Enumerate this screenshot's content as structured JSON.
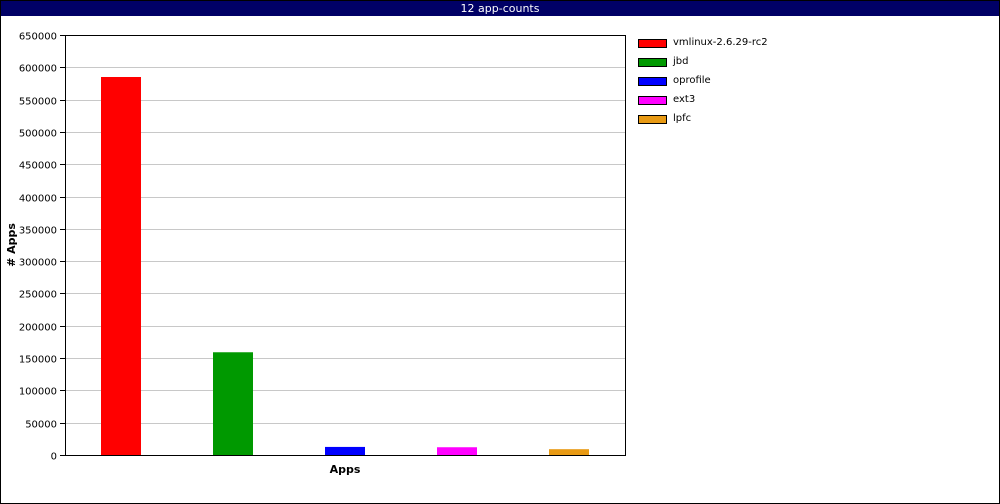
{
  "window": {
    "title": "12 app-counts"
  },
  "chart_data": {
    "type": "bar",
    "title": "12 app-counts",
    "xlabel": "Apps",
    "ylabel": "# Apps",
    "ylim": [
      0,
      650000
    ],
    "yticks": [
      0,
      50000,
      100000,
      150000,
      200000,
      250000,
      300000,
      350000,
      400000,
      450000,
      500000,
      550000,
      600000,
      650000
    ],
    "grid": true,
    "legend_position": "right",
    "categories": [
      "vmlinux-2.6.29-rc2",
      "jbd",
      "oprofile",
      "ext3",
      "lpfc"
    ],
    "values": [
      585000,
      159000,
      12500,
      12000,
      9000
    ],
    "colors": [
      "#ff0000",
      "#009900",
      "#0000ff",
      "#ff00ff",
      "#e89a14"
    ]
  }
}
